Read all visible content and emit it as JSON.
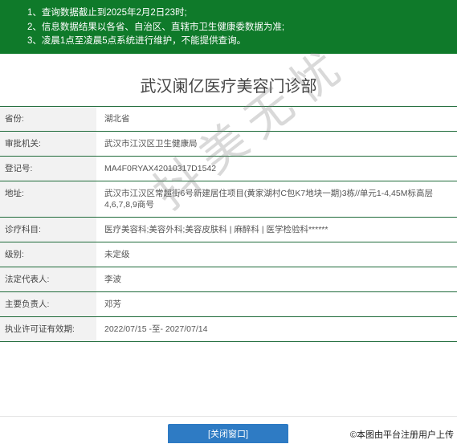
{
  "notice": {
    "lines": [
      "1、查询数据截止到2025年2月2日23时;",
      "2、信息数据结果以各省、自治区、直辖市卫生健康委数据为准;",
      "3、凌晨1点至凌晨5点系统进行维护，不能提供查询。"
    ]
  },
  "title": "武汉阑亿医疗美容门诊部",
  "rows": [
    {
      "label": "省份:",
      "value": "湖北省"
    },
    {
      "label": "审批机关:",
      "value": "武汉市江汉区卫生健康局"
    },
    {
      "label": "登记号:",
      "value": "MA4F0RYAX42010317D1542"
    },
    {
      "label": "地址:",
      "value": "武汉市江汉区常超街6号新建居住项目(黄家湖村C包K7地块一期)3栋//单元1-4,45M标高层4,6,7,8,9商号"
    },
    {
      "label": "诊疗科目:",
      "value": "医疗美容科;美容外科;美容皮肤科 | 麻醉科 | 医学检验科******"
    },
    {
      "label": "级别:",
      "value": "未定级"
    },
    {
      "label": "法定代表人:",
      "value": "李波"
    },
    {
      "label": "主要负责人:",
      "value": "邓芳"
    },
    {
      "label": "执业许可证有效期:",
      "value": "2022/07/15 -至- 2027/07/14"
    }
  ],
  "watermark": "抖美无忧",
  "buttons": {
    "close": "[关闭窗口]"
  },
  "credit": "©本图由平台注册用户上传"
}
